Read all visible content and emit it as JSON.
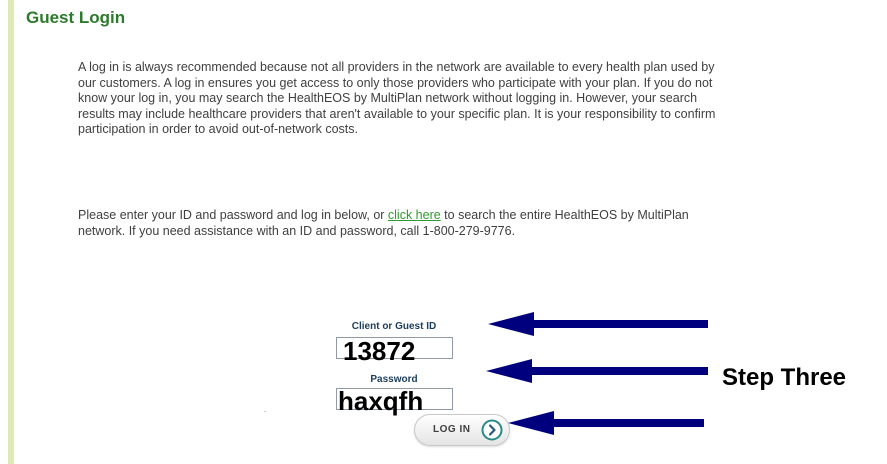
{
  "page": {
    "title": "Guest Login",
    "intro": "A log in is always recommended because not all providers in the network are available to every health plan used by our customers. A log in ensures you get access to only those providers who participate with your plan. If you do not know your log in, you may search the HealthEOS by MultiPlan network without logging in. However, your search results may include healthcare providers that aren't available to your specific plan. It is your responsibility to confirm participation in order to avoid out-of-network costs.",
    "instructions": {
      "before_link": "Please enter your ID and password and log in below, or ",
      "link_text": "click here",
      "after_link": " to search the entire HealthEOS by MultiPlan network. If you need assistance with an ID and password, call 1-800-279-9776."
    }
  },
  "login_form": {
    "id_label": "Client or Guest ID",
    "id_value": "13872",
    "password_label": "Password",
    "password_value": "haxqfh",
    "login_button_label": "LOG IN",
    "login_button_icon": "chevron-right-circle-icon"
  },
  "annotation": {
    "step_label": "Step Three",
    "arrow_color": "#00007f"
  },
  "colors": {
    "title": "#2c7a2c",
    "link": "#2f9b2f",
    "left_bar": "#dfe9b7",
    "body_text": "#3f3f3f"
  }
}
